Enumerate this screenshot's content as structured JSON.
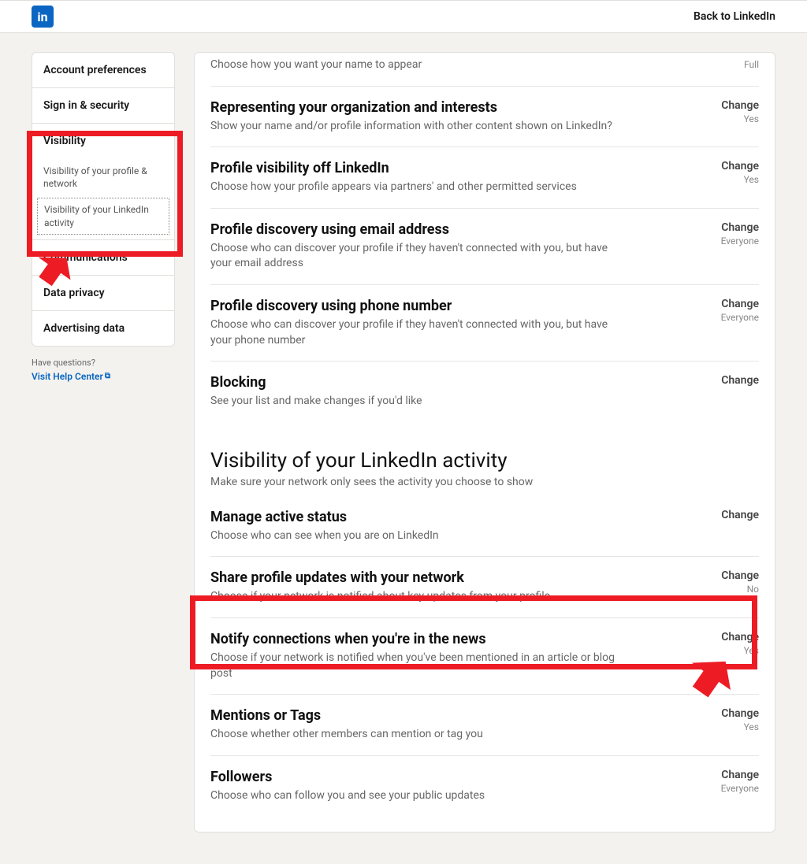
{
  "topbar": {
    "back": "Back to LinkedIn"
  },
  "sidebar": {
    "items": [
      "Account preferences",
      "Sign in & security",
      "Visibility",
      "Communications",
      "Data privacy",
      "Advertising data"
    ],
    "vis_sub1": "Visibility of your profile & network",
    "vis_sub2": "Visibility of your LinkedIn activity",
    "help_q": "Have questions?",
    "help_link": "Visit Help Center"
  },
  "rows1": [
    {
      "title": "",
      "desc": "Choose how you want your name to appear",
      "action": "",
      "value": "Full"
    },
    {
      "title": "Representing your organization and interests",
      "desc": "Show your name and/or profile information with other content shown on LinkedIn?",
      "action": "Change",
      "value": "Yes"
    },
    {
      "title": "Profile visibility off LinkedIn",
      "desc": "Choose how your profile appears via partners' and other permitted services",
      "action": "Change",
      "value": "Yes"
    },
    {
      "title": "Profile discovery using email address",
      "desc": "Choose who can discover your profile if they haven't connected with you, but have your email address",
      "action": "Change",
      "value": "Everyone"
    },
    {
      "title": "Profile discovery using phone number",
      "desc": "Choose who can discover your profile if they haven't connected with you, but have your phone number",
      "action": "Change",
      "value": "Everyone"
    },
    {
      "title": "Blocking",
      "desc": "See your list and make changes if you'd like",
      "action": "Change",
      "value": ""
    }
  ],
  "section2": {
    "title": "Visibility of your LinkedIn activity",
    "sub": "Make sure your network only sees the activity you choose to show"
  },
  "rows2": [
    {
      "title": "Manage active status",
      "desc": "Choose who can see when you are on LinkedIn",
      "action": "Change",
      "value": ""
    },
    {
      "title": "Share profile updates with your network",
      "desc": "Choose if your network is notified about key updates from your profile",
      "action": "Change",
      "value": "No"
    },
    {
      "title": "Notify connections when you're in the news",
      "desc": "Choose if your network is notified when you've been mentioned in an article or blog post",
      "action": "Change",
      "value": "Yes"
    },
    {
      "title": "Mentions or Tags",
      "desc": "Choose whether other members can mention or tag you",
      "action": "Change",
      "value": "Yes"
    },
    {
      "title": "Followers",
      "desc": "Choose who can follow you and see your public updates",
      "action": "Change",
      "value": "Everyone"
    }
  ]
}
